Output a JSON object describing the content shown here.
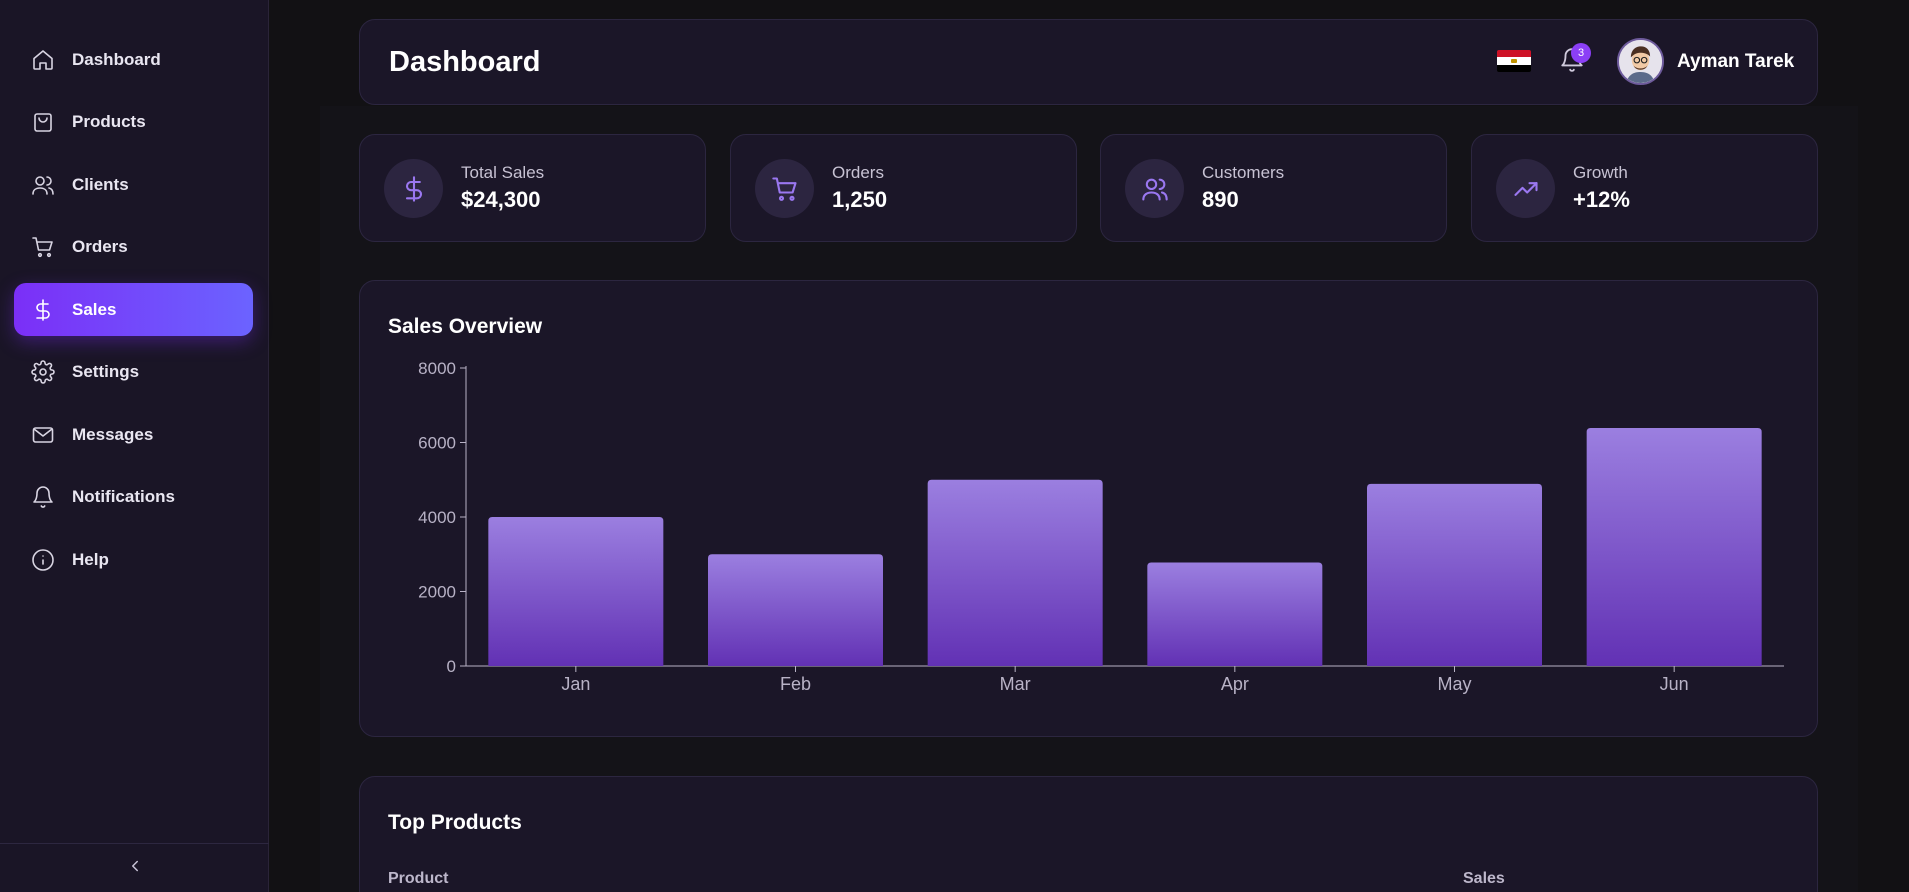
{
  "sidebar": {
    "items": [
      {
        "label": "Dashboard",
        "icon": "home-icon"
      },
      {
        "label": "Products",
        "icon": "shopping-bag-icon"
      },
      {
        "label": "Clients",
        "icon": "users-icon"
      },
      {
        "label": "Orders",
        "icon": "cart-icon"
      },
      {
        "label": "Sales",
        "icon": "dollar-icon",
        "active": true
      },
      {
        "label": "Settings",
        "icon": "gear-icon"
      },
      {
        "label": "Messages",
        "icon": "mail-icon"
      },
      {
        "label": "Notifications",
        "icon": "bell-icon"
      },
      {
        "label": "Help",
        "icon": "info-icon"
      }
    ],
    "collapse_icon": "chevron-left-icon"
  },
  "header": {
    "title": "Dashboard",
    "notification_count": "3",
    "user_name": "Ayman Tarek",
    "flag": "egypt-flag-icon"
  },
  "stats": [
    {
      "label": "Total Sales",
      "value": "$24,300",
      "icon": "dollar-icon"
    },
    {
      "label": "Orders",
      "value": "1,250",
      "icon": "cart-icon"
    },
    {
      "label": "Customers",
      "value": "890",
      "icon": "users-icon"
    },
    {
      "label": "Growth",
      "value": "+12%",
      "icon": "trending-up-icon"
    }
  ],
  "sales_overview": {
    "title": "Sales Overview"
  },
  "chart_data": {
    "type": "bar",
    "title": "Sales Overview",
    "categories": [
      "Jan",
      "Feb",
      "Mar",
      "Apr",
      "May",
      "Jun"
    ],
    "values": [
      4000,
      3000,
      5000,
      2780,
      4890,
      6390
    ],
    "yticks": [
      0,
      2000,
      4000,
      6000,
      8000
    ],
    "ylim": [
      0,
      8000
    ],
    "xlabel": "",
    "ylabel": "",
    "grid": false,
    "colors": {
      "bar_top": "#9b7fe0",
      "bar_bottom": "#6231b4",
      "axis": "#b8b2c6"
    }
  },
  "top_products": {
    "title": "Top Products",
    "columns": [
      "Product",
      "Sales"
    ]
  },
  "colors": {
    "accent": "#7b2ff7",
    "accent_end": "#6b63ff",
    "card_bg": "#1b1628",
    "page_bg": "#121114"
  }
}
